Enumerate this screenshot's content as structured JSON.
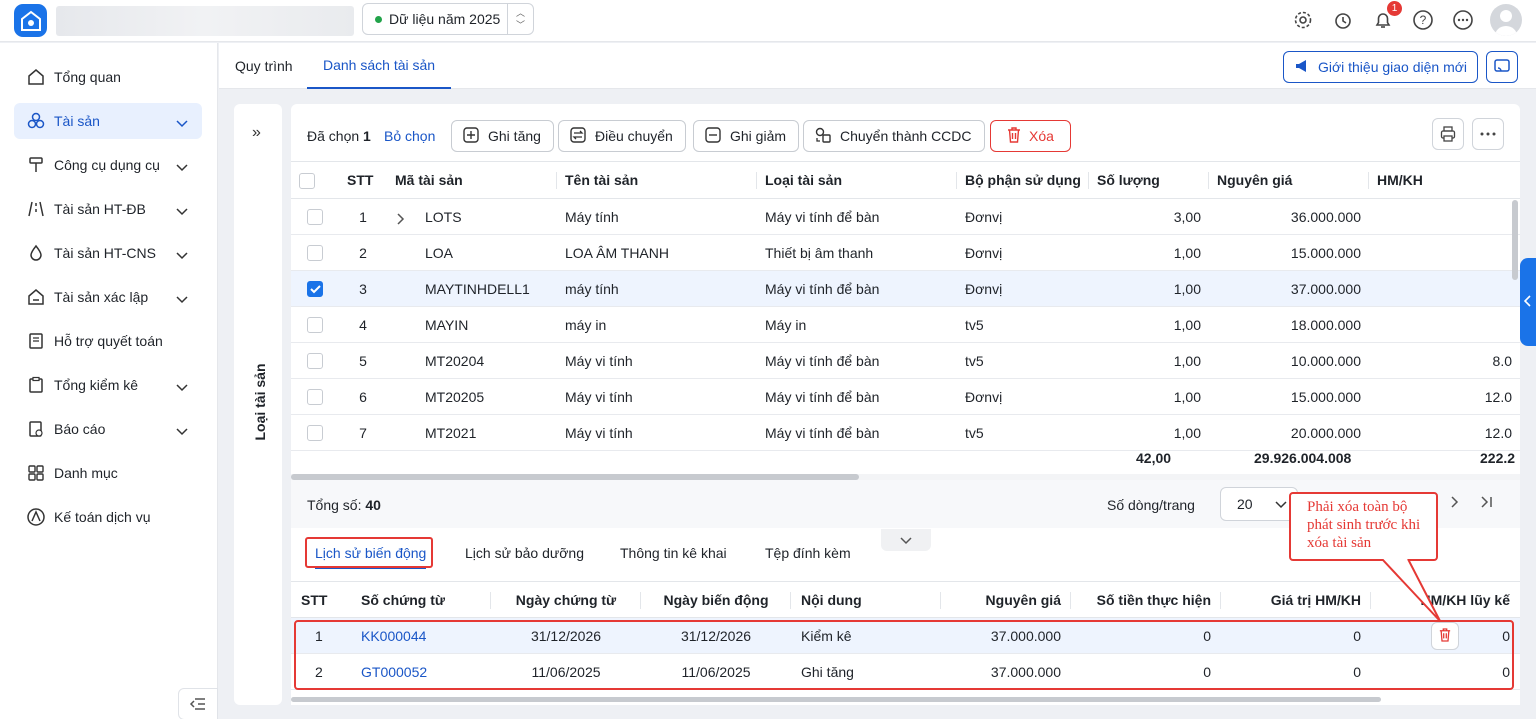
{
  "header": {
    "year_label": "Dữ liệu năm 2025",
    "notification_count": "1"
  },
  "sidebar": {
    "items": [
      {
        "label": "Tổng quan",
        "icon": "home-icon",
        "expandable": false
      },
      {
        "label": "Tài sản",
        "icon": "assets-icon",
        "expandable": true,
        "active": true
      },
      {
        "label": "Công cụ dụng cụ",
        "icon": "tools-icon",
        "expandable": true
      },
      {
        "label": "Tài sản HT-ĐB",
        "icon": "road-icon",
        "expandable": true
      },
      {
        "label": "Tài sản HT-CNS",
        "icon": "water-icon",
        "expandable": true
      },
      {
        "label": "Tài sản xác lập",
        "icon": "establish-icon",
        "expandable": true
      },
      {
        "label": "Hỗ trợ quyết toán",
        "icon": "book-icon",
        "expandable": false
      },
      {
        "label": "Tổng kiểm kê",
        "icon": "clipboard-icon",
        "expandable": true
      },
      {
        "label": "Báo cáo",
        "icon": "report-icon",
        "expandable": true
      },
      {
        "label": "Danh mục",
        "icon": "grid-icon",
        "expandable": false
      },
      {
        "label": "Kế toán dịch vụ",
        "icon": "accounting-icon",
        "expandable": false
      }
    ]
  },
  "tabs": [
    {
      "label": "Quy trình"
    },
    {
      "label": "Danh sách tài sản",
      "active": true
    }
  ],
  "intro_button": "Giới thiệu giao diện mới",
  "category_panel": {
    "label": "Loại tài sản",
    "expand": "»"
  },
  "toolbar": {
    "selected_label": "Đã chọn",
    "selected_count": "1",
    "deselect": "Bỏ chọn",
    "buttons": {
      "increase": "Ghi tăng",
      "transfer": "Điều chuyển",
      "decrease": "Ghi giảm",
      "convert": "Chuyển thành CCDC",
      "delete": "Xóa"
    }
  },
  "grid": {
    "headers": {
      "stt": "STT",
      "code": "Mã tài sản",
      "name": "Tên tài sản",
      "type": "Loại tài sản",
      "dept": "Bộ phận sử dụng",
      "qty": "Số lượng",
      "price": "Nguyên giá",
      "dep": "HM/KH"
    },
    "rows": [
      {
        "stt": "1",
        "code": "LOTS",
        "name": "Máy tính",
        "type": "Máy vi tính để bàn",
        "dept": "Đơnvị",
        "qty": "3,00",
        "price": "36.000.000",
        "dep": "",
        "expandable": true
      },
      {
        "stt": "2",
        "code": "LOA",
        "name": "LOA ÂM THANH",
        "type": "Thiết bị âm thanh",
        "dept": "Đơnvị",
        "qty": "1,00",
        "price": "15.000.000",
        "dep": ""
      },
      {
        "stt": "3",
        "code": "MAYTINHDELL1",
        "name": "máy tính",
        "type": "Máy vi tính để bàn",
        "dept": "Đơnvị",
        "qty": "1,00",
        "price": "37.000.000",
        "dep": "",
        "checked": true
      },
      {
        "stt": "4",
        "code": "MAYIN",
        "name": "máy in",
        "type": "Máy in",
        "dept": "tv5",
        "qty": "1,00",
        "price": "18.000.000",
        "dep": ""
      },
      {
        "stt": "5",
        "code": "MT20204",
        "name": "Máy vi tính",
        "type": "Máy vi tính để bàn",
        "dept": "tv5",
        "qty": "1,00",
        "price": "10.000.000",
        "dep": "8.0"
      },
      {
        "stt": "6",
        "code": "MT20205",
        "name": "Máy vi tính",
        "type": "Máy vi tính để bàn",
        "dept": "Đơnvị",
        "qty": "1,00",
        "price": "15.000.000",
        "dep": "12.0"
      },
      {
        "stt": "7",
        "code": "MT2021",
        "name": "Máy vi tính",
        "type": "Máy vi tính để bàn",
        "dept": "tv5",
        "qty": "1,00",
        "price": "20.000.000",
        "dep": "12.0"
      }
    ],
    "totals": {
      "qty": "42,00",
      "price": "29.926.004.008",
      "dep": "222.2"
    }
  },
  "pager": {
    "total_label": "Tổng số:",
    "total": "40",
    "rows_per_page_label": "Số dòng/trang",
    "rows_per_page": "20"
  },
  "bottom": {
    "tabs": [
      {
        "label": "Lịch sử biến động",
        "active": true
      },
      {
        "label": "Lịch sử bảo dưỡng"
      },
      {
        "label": "Thông tin kê khai"
      },
      {
        "label": "Tệp đính kèm"
      }
    ],
    "headers": {
      "stt": "STT",
      "doc": "Số chứng từ",
      "doc_date": "Ngày chứng từ",
      "change_date": "Ngày biến động",
      "content": "Nội dung",
      "price": "Nguyên giá",
      "amount": "Số tiền thực hiện",
      "dep_value": "Giá trị HM/KH",
      "dep_acc": "HM/KH lũy kế"
    },
    "rows": [
      {
        "stt": "1",
        "doc": "KK000044",
        "doc_date": "31/12/2026",
        "change_date": "31/12/2026",
        "content": "Kiểm kê",
        "price": "37.000.000",
        "amount": "0",
        "dep_value": "0",
        "dep_acc": "0"
      },
      {
        "stt": "2",
        "doc": "GT000052",
        "doc_date": "11/06/2025",
        "change_date": "11/06/2025",
        "content": "Ghi tăng",
        "price": "37.000.000",
        "amount": "0",
        "dep_value": "0",
        "dep_acc": "0"
      }
    ]
  },
  "callout": {
    "text": "Phải xóa toàn bộ phát sinh trước khi xóa tài sản"
  },
  "colors": {
    "accent": "#1a73e8",
    "link": "#1a56c7",
    "danger": "#e53935"
  }
}
